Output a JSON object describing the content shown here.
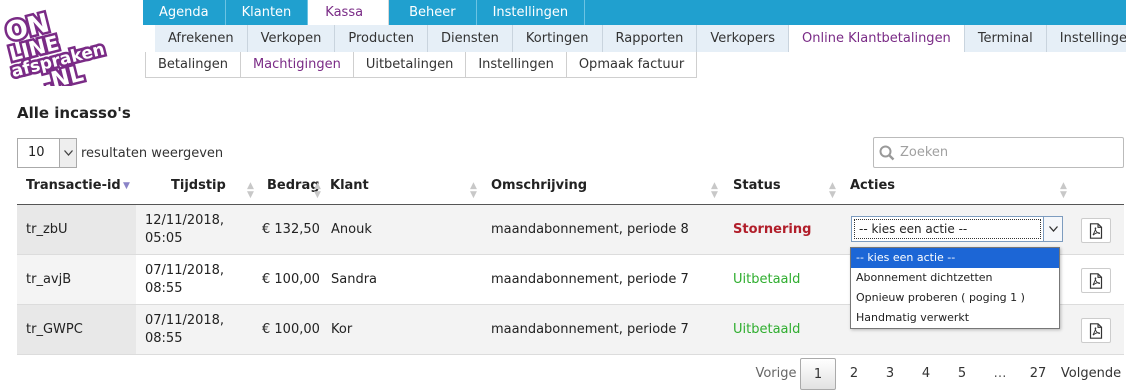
{
  "logo": {
    "line1": "ON",
    "line2": "LINE",
    "line3": "afspraken",
    "line4": ".NL"
  },
  "topnav": [
    {
      "label": "Agenda",
      "active": false
    },
    {
      "label": "Klanten",
      "active": false
    },
    {
      "label": "Kassa",
      "active": true
    },
    {
      "label": "Beheer",
      "active": false
    },
    {
      "label": "Instellingen",
      "active": false
    }
  ],
  "subnav": [
    {
      "label": "Afrekenen"
    },
    {
      "label": "Verkopen"
    },
    {
      "label": "Producten"
    },
    {
      "label": "Diensten"
    },
    {
      "label": "Kortingen"
    },
    {
      "label": "Rapporten"
    },
    {
      "label": "Verkopers"
    },
    {
      "label": "Online Klantbetalingen",
      "active": true
    },
    {
      "label": "Terminal"
    },
    {
      "label": "Instellingen"
    }
  ],
  "thirdnav": [
    {
      "label": "Betalingen"
    },
    {
      "label": "Machtigingen",
      "active": true
    },
    {
      "label": "Uitbetalingen"
    },
    {
      "label": "Instellingen"
    },
    {
      "label": "Opmaak factuur"
    }
  ],
  "page_title": "Alle incasso's",
  "length": {
    "value": "10",
    "label": "resultaten weergeven"
  },
  "search": {
    "placeholder": "Zoeken",
    "value": ""
  },
  "table": {
    "headers": {
      "id": "Transactie-id",
      "time": "Tijdstip",
      "amount": "Bedrag",
      "client": "Klant",
      "description": "Omschrijving",
      "status": "Status",
      "actions": "Acties"
    },
    "rows": [
      {
        "id": "tr_zbU",
        "date": "12/11/2018,",
        "time": "05:05",
        "amount": "€ 132,50",
        "client": "Anouk",
        "description": "maandabonnement, periode 8",
        "status": "Stornering",
        "status_type": "storno",
        "action": "-- kies een actie --"
      },
      {
        "id": "tr_avjB",
        "date": "07/11/2018,",
        "time": "08:55",
        "amount": "€ 100,00",
        "client": "Sandra",
        "description": "maandabonnement, periode 7",
        "status": "Uitbetaald",
        "status_type": "paid"
      },
      {
        "id": "tr_GWPC",
        "date": "07/11/2018,",
        "time": "08:55",
        "amount": "€ 100,00",
        "client": "Kor",
        "description": "maandabonnement, periode 7",
        "status": "Uitbetaald",
        "status_type": "paid"
      }
    ]
  },
  "action_dropdown": {
    "options": [
      {
        "label": "-- kies een actie --",
        "selected": true
      },
      {
        "label": "Abonnement dichtzetten"
      },
      {
        "label": "Opnieuw proberen ( poging 1 )"
      },
      {
        "label": "Handmatig verwerkt"
      }
    ]
  },
  "pagination": {
    "prev": "Vorige",
    "pages": [
      "1",
      "2",
      "3",
      "4",
      "5"
    ],
    "ellipsis": "…",
    "last": "27",
    "next": "Volgende",
    "current": "1"
  },
  "colors": {
    "nav_blue": "#20a0cf",
    "active_purple": "#7a2b86",
    "storno_red": "#b11e2a",
    "paid_green": "#2fae2f",
    "dropdown_highlight": "#1c66d6"
  }
}
